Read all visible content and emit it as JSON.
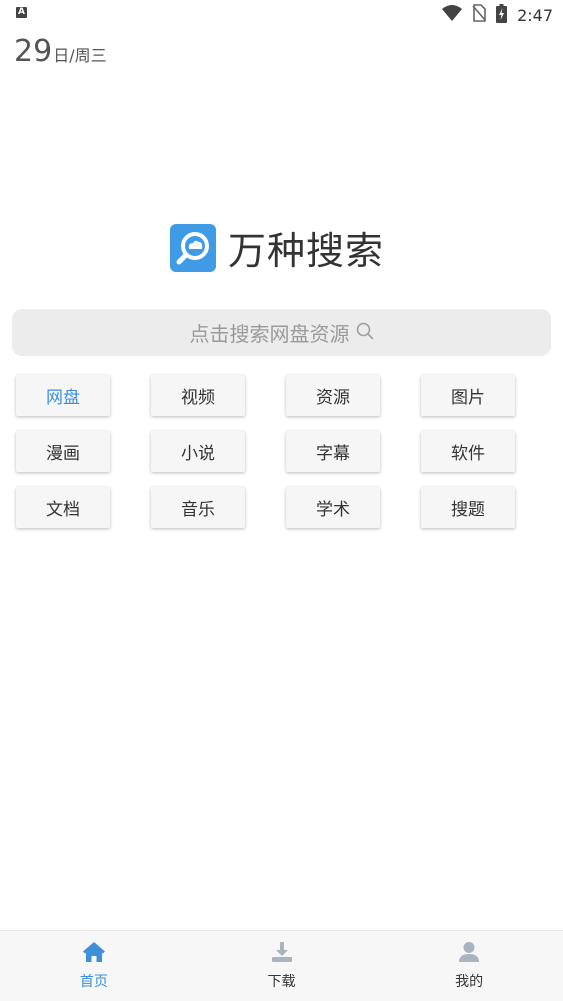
{
  "status_bar": {
    "notification_glyph": "A",
    "time": "2:47",
    "icons": [
      "wifi-icon",
      "no-sim-icon",
      "battery-charging-icon"
    ]
  },
  "date": {
    "day": "29",
    "suffix": "日/周三"
  },
  "logo": {
    "title": "万种搜索",
    "icon": "search-cloud-logo-icon",
    "color": "#3f9be6"
  },
  "search": {
    "placeholder": "点击搜索网盘资源",
    "icon": "search-icon"
  },
  "categories": [
    {
      "label": "网盘",
      "active": true
    },
    {
      "label": "视频",
      "active": false
    },
    {
      "label": "资源",
      "active": false
    },
    {
      "label": "图片",
      "active": false
    },
    {
      "label": "漫画",
      "active": false
    },
    {
      "label": "小说",
      "active": false
    },
    {
      "label": "字幕",
      "active": false
    },
    {
      "label": "软件",
      "active": false
    },
    {
      "label": "文档",
      "active": false
    },
    {
      "label": "音乐",
      "active": false
    },
    {
      "label": "学术",
      "active": false
    },
    {
      "label": "搜题",
      "active": false
    }
  ],
  "bottom_nav": [
    {
      "label": "首页",
      "icon": "home-icon",
      "active": true
    },
    {
      "label": "下载",
      "icon": "download-icon",
      "active": false
    },
    {
      "label": "我的",
      "icon": "profile-icon",
      "active": false
    }
  ],
  "colors": {
    "accent": "#3d8fd8",
    "inactive_icon": "#a9b4c2"
  }
}
